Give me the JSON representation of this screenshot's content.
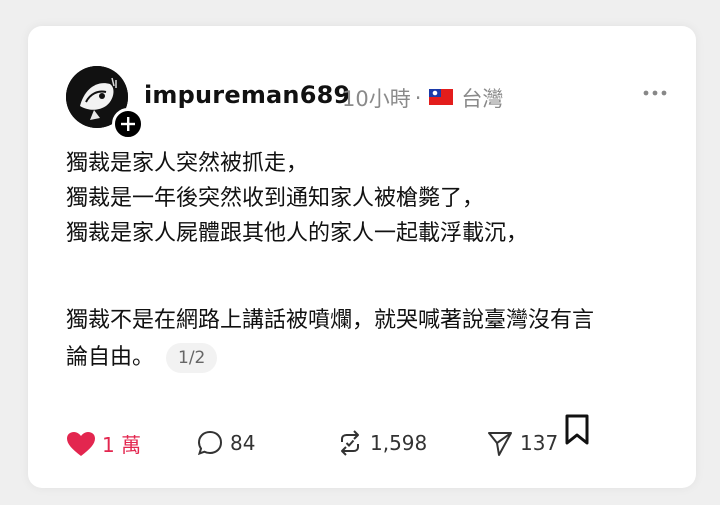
{
  "post": {
    "username": "impureman689",
    "time": "10小時",
    "separator": "·",
    "location": "台灣",
    "paragraph1": [
      "獨裁是家人突然被抓走，",
      "獨裁是一年後突然收到通知家人被槍斃了，",
      "獨裁是家人屍體跟其他人的家人一起載浮載沉，"
    ],
    "paragraph2": [
      "獨裁不是在網路上講話被噴爛，就哭喊著說臺灣沒有言",
      "論自由。"
    ],
    "pager": "1/2"
  },
  "actions": {
    "likes": "1 萬",
    "comments": "84",
    "reposts": "1,598",
    "shares": "137"
  },
  "colors": {
    "like": "#e3264f",
    "text": "#111111",
    "meta": "#8a8a8a"
  },
  "icons": [
    "heart-icon",
    "comment-icon",
    "repost-icon",
    "share-icon",
    "bookmark-icon",
    "more-icon",
    "plus-icon",
    "taiwan-flag-icon"
  ]
}
